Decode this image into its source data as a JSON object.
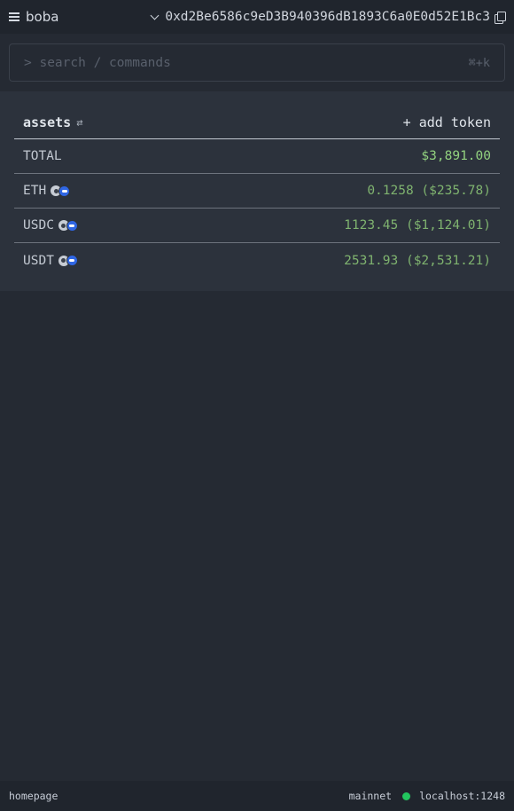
{
  "topbar": {
    "app_name": "boba",
    "account_address": "0xd2Be6586c9eD3B940396dB1893C6a0E0d52E1Bc3"
  },
  "search": {
    "placeholder": "> search / commands",
    "shortcut": "⌘+k"
  },
  "assets": {
    "title": "assets",
    "add_token_label": "+ add token",
    "total_label": "TOTAL",
    "total_value": "$3,891.00",
    "tokens": [
      {
        "symbol": "ETH",
        "amount": "0.1258 ($235.78)"
      },
      {
        "symbol": "USDC",
        "amount": "1123.45 ($1,124.01)"
      },
      {
        "symbol": "USDT",
        "amount": "2531.93 ($2,531.21)"
      }
    ]
  },
  "statusbar": {
    "page": "homepage",
    "network": "mainnet",
    "host": "localhost:1248",
    "network_status_color": "#22c55e"
  },
  "icons": [
    "menu-icon",
    "chevron-down-icon",
    "copy-icon",
    "sort-icon",
    "token-icon"
  ]
}
